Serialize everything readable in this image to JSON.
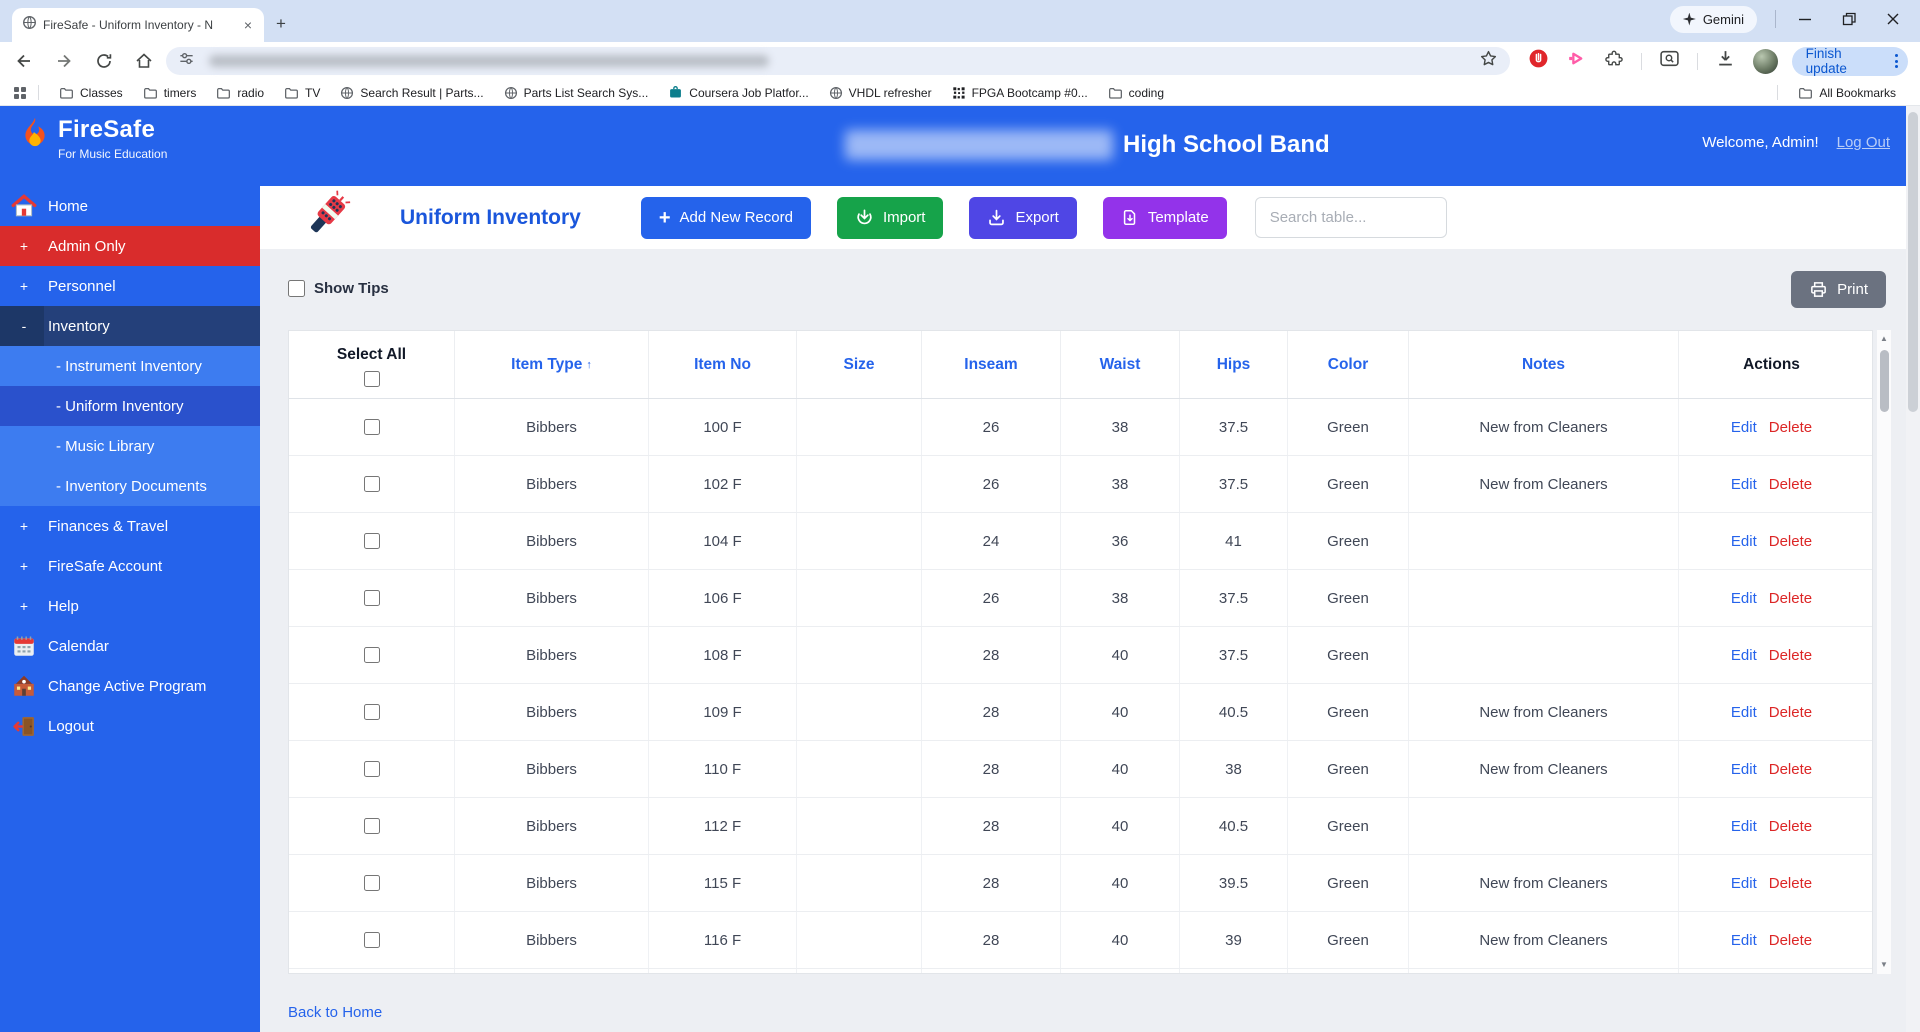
{
  "browser": {
    "tab_title": "FireSafe - Uniform Inventory - N",
    "tab_close": "×",
    "new_tab": "+",
    "gemini_label": "Gemini",
    "update_button": "Finish update",
    "bookmarks": [
      {
        "type": "folder",
        "label": "Classes"
      },
      {
        "type": "folder",
        "label": "timers"
      },
      {
        "type": "folder",
        "label": "radio"
      },
      {
        "type": "folder",
        "label": "TV"
      },
      {
        "type": "globe",
        "label": "Search Result | Parts..."
      },
      {
        "type": "globe",
        "label": "Parts List Search Sys..."
      },
      {
        "type": "briefcase",
        "label": "Coursera Job Platfor..."
      },
      {
        "type": "globe",
        "label": "VHDL refresher"
      },
      {
        "type": "pixel",
        "label": "FPGA Bootcamp #0..."
      },
      {
        "type": "folder",
        "label": "coding"
      }
    ],
    "all_bookmarks": "All Bookmarks"
  },
  "header": {
    "brand": "FireSafe",
    "brand_sub": "For Music Education",
    "school_suffix": "High School Band",
    "welcome": "Welcome, Admin!",
    "logout_link": "Log Out"
  },
  "sidebar": {
    "items": [
      {
        "prefix": "",
        "label": "Home",
        "icon": "home"
      },
      {
        "prefix": "+",
        "label": "Admin Only"
      },
      {
        "prefix": "+",
        "label": "Personnel"
      },
      {
        "prefix": "-",
        "label": "Inventory"
      },
      {
        "prefix": "",
        "label": "- Instrument Inventory"
      },
      {
        "prefix": "",
        "label": "- Uniform Inventory"
      },
      {
        "prefix": "",
        "label": "- Music Library"
      },
      {
        "prefix": "",
        "label": "- Inventory Documents"
      },
      {
        "prefix": "+",
        "label": "Finances & Travel"
      },
      {
        "prefix": "+",
        "label": "FireSafe Account"
      },
      {
        "prefix": "+",
        "label": "Help"
      },
      {
        "prefix": "",
        "label": "Calendar",
        "icon": "calendar"
      },
      {
        "prefix": "",
        "label": "Change Active Program",
        "icon": "school"
      },
      {
        "prefix": "",
        "label": "Logout",
        "icon": "door"
      }
    ]
  },
  "toolbar": {
    "page_title": "Uniform Inventory",
    "add_button": "Add New Record",
    "add_plus": "+",
    "import_button": "Import",
    "export_button": "Export",
    "template_button": "Template",
    "search_placeholder": "Search table..."
  },
  "controls": {
    "show_tips_label": "Show Tips",
    "print_button": "Print"
  },
  "table": {
    "columns": [
      "Select All",
      "Item Type",
      "Item No",
      "Size",
      "Inseam",
      "Waist",
      "Hips",
      "Color",
      "Notes",
      "Actions"
    ],
    "sort_column": "Item Type",
    "sort_icon": "↑",
    "edit_label": "Edit",
    "delete_label": "Delete",
    "rows": [
      {
        "item_type": "Bibbers",
        "item_no": "100 F",
        "size": "",
        "inseam": "26",
        "waist": "38",
        "hips": "37.5",
        "color": "Green",
        "notes": "New from Cleaners"
      },
      {
        "item_type": "Bibbers",
        "item_no": "102 F",
        "size": "",
        "inseam": "26",
        "waist": "38",
        "hips": "37.5",
        "color": "Green",
        "notes": "New from Cleaners"
      },
      {
        "item_type": "Bibbers",
        "item_no": "104 F",
        "size": "",
        "inseam": "24",
        "waist": "36",
        "hips": "41",
        "color": "Green",
        "notes": ""
      },
      {
        "item_type": "Bibbers",
        "item_no": "106 F",
        "size": "",
        "inseam": "26",
        "waist": "38",
        "hips": "37.5",
        "color": "Green",
        "notes": ""
      },
      {
        "item_type": "Bibbers",
        "item_no": "108 F",
        "size": "",
        "inseam": "28",
        "waist": "40",
        "hips": "37.5",
        "color": "Green",
        "notes": ""
      },
      {
        "item_type": "Bibbers",
        "item_no": "109 F",
        "size": "",
        "inseam": "28",
        "waist": "40",
        "hips": "40.5",
        "color": "Green",
        "notes": "New from Cleaners"
      },
      {
        "item_type": "Bibbers",
        "item_no": "110 F",
        "size": "",
        "inseam": "28",
        "waist": "40",
        "hips": "38",
        "color": "Green",
        "notes": "New from Cleaners"
      },
      {
        "item_type": "Bibbers",
        "item_no": "112 F",
        "size": "",
        "inseam": "28",
        "waist": "40",
        "hips": "40.5",
        "color": "Green",
        "notes": ""
      },
      {
        "item_type": "Bibbers",
        "item_no": "115 F",
        "size": "",
        "inseam": "28",
        "waist": "40",
        "hips": "39.5",
        "color": "Green",
        "notes": "New from Cleaners"
      },
      {
        "item_type": "Bibbers",
        "item_no": "116 F",
        "size": "",
        "inseam": "28",
        "waist": "40",
        "hips": "39",
        "color": "Green",
        "notes": "New from Cleaners"
      }
    ]
  },
  "footer": {
    "back_link": "Back to Home"
  },
  "colors": {
    "header_blue": "#2563eb",
    "admin_red": "#d92c2c",
    "expanded_navy": "#24407a",
    "sub_blue": "#3d7cf0",
    "active_sub_blue": "#2a51cc",
    "import_green": "#16a34a",
    "export_indigo": "#4f46e5",
    "template_purple": "#9333ea",
    "print_gray": "#6b7280",
    "delete_red": "#dc2626"
  }
}
